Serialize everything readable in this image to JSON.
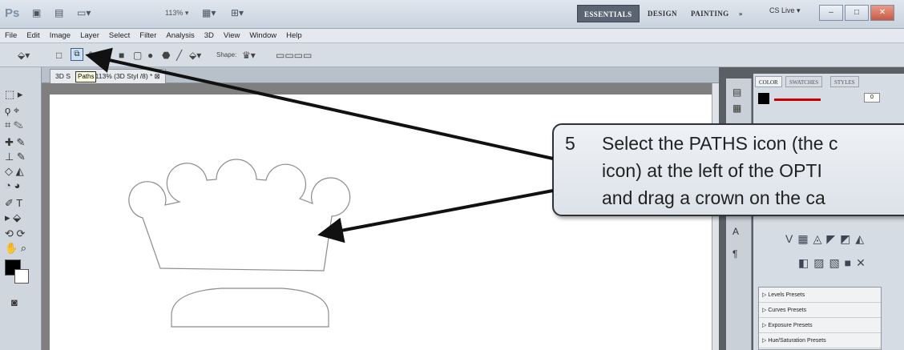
{
  "appbar": {
    "logo": "Ps",
    "zoom": "113% ▾",
    "workspaces": [
      "ESSENTIALS",
      "DESIGN",
      "PAINTING",
      "»"
    ],
    "cslive": "CS Live ▾"
  },
  "menu": [
    "File",
    "Edit",
    "Image",
    "Layer",
    "Select",
    "Filter",
    "Analysis",
    "3D",
    "View",
    "Window",
    "Help"
  ],
  "options": {
    "shape_label": "Shape:"
  },
  "document": {
    "tab_title": "3D S",
    "tab_suffix": "113% (3D Styl",
    "tab_tail": "/8) * ⊠"
  },
  "tooltip": "Paths",
  "panel": {
    "tabs": [
      "COLOR",
      "SWATCHES",
      "STYLES"
    ],
    "slider_value": "0",
    "presets": [
      "Levels Presets",
      "Curves Presets",
      "Exposure Presets",
      "Hue/Saturation Presets"
    ]
  },
  "callout": {
    "number": "5",
    "lines": [
      "Select the PATHS icon (the c",
      "icon) at the left of the OPTI",
      "and drag a crown on the ca"
    ]
  },
  "colors": {
    "accent": "#5a6473",
    "callout_border": "#2f3238",
    "arrow": "#111111"
  }
}
